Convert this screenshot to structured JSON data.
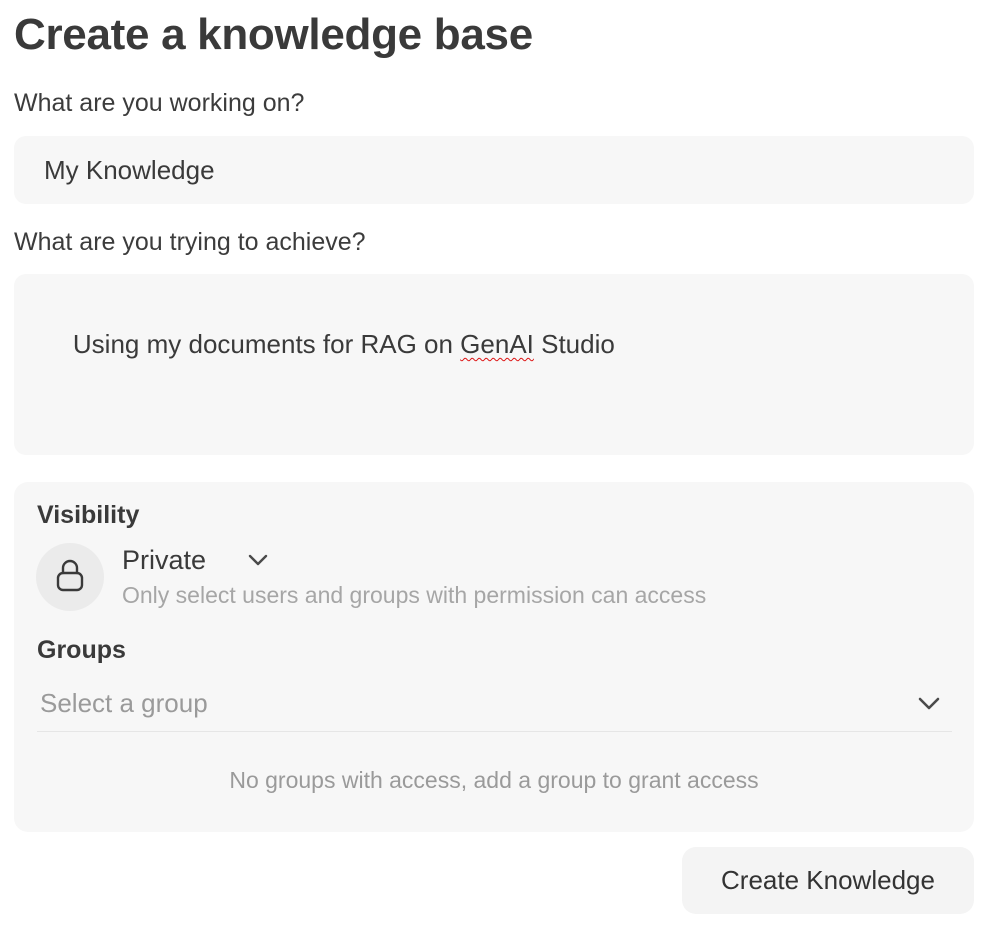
{
  "page": {
    "title": "Create a knowledge base"
  },
  "name_field": {
    "label": "What are you working on?",
    "value": "My Knowledge"
  },
  "description_field": {
    "label": "What are you trying to achieve?",
    "value_before": "Using my documents for RAG on ",
    "value_misspelled": "GenAI",
    "value_after": " Studio"
  },
  "access": {
    "visibility_title": "Visibility",
    "visibility_icon": "lock-icon",
    "visibility_value": "Private",
    "visibility_description": "Only select users and groups with permission can access",
    "groups_title": "Groups",
    "groups_placeholder": "Select a group",
    "groups_empty_message": "No groups with access, add a group to grant access"
  },
  "actions": {
    "create_label": "Create Knowledge"
  },
  "colors": {
    "panel_background": "#f7f7f7",
    "muted_text": "#9a9a9a",
    "spellcheck_underline": "#dd1111"
  }
}
